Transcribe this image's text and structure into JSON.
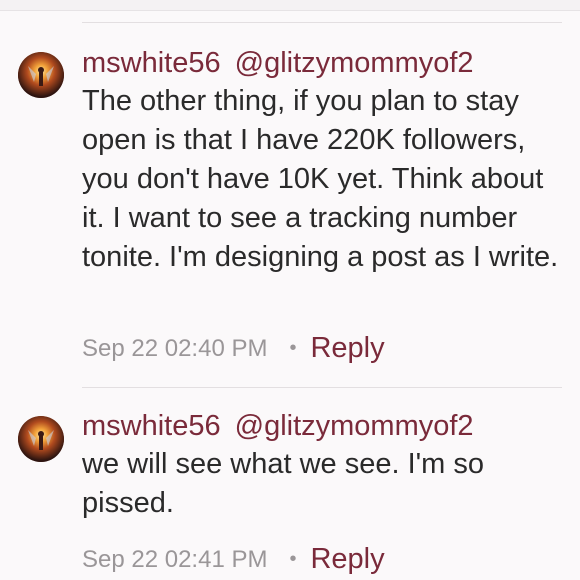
{
  "comments": [
    {
      "username": "mswhite56",
      "mention": "@glitzymommyof2",
      "text": "The other thing, if you plan to stay open is that I have 220K followers, you don't have 10K yet. Think about it. I want to see a tracking number tonite. I'm designing a post as I write.",
      "timestamp": "Sep 22 02:40 PM",
      "separator": "•",
      "reply_label": "Reply"
    },
    {
      "username": "mswhite56",
      "mention": "@glitzymommyof2",
      "text": "we will see what we see. I'm so pissed.",
      "timestamp": "Sep 22 02:41 PM",
      "separator": "•",
      "reply_label": "Reply"
    }
  ],
  "colors": {
    "accent": "#7a2a3a",
    "body_text": "#2a2a2a",
    "muted_text": "#9a9698",
    "background": "#fbf9fa",
    "divider": "#e3dfe1"
  }
}
